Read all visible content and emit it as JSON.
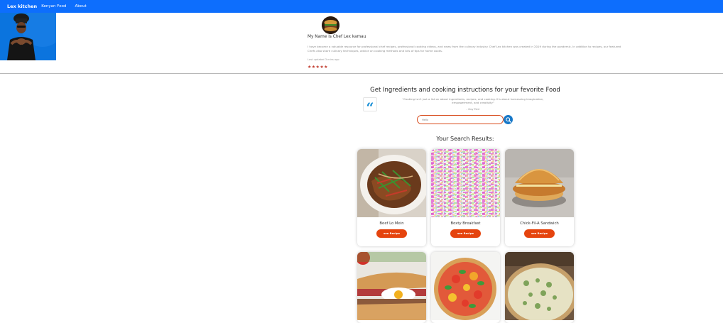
{
  "nav": {
    "brand": "Lex kitchen",
    "links": [
      "Kenyan Food",
      "About"
    ]
  },
  "profile": {
    "name": "My Name is Chef Lex kamau",
    "bio": "I have become a valuable resource for professional chef recipes, professional cooking videos, and news from the culinary industry. Chef Lex kitchen was created in 2019 during the pandemic. In addition to recipes, our featured Chefs also share culinary techniques, advice on cooking methods and lots of tips for home cooks.",
    "updated": "Last updated 3 mins ago",
    "rating": 5,
    "stars": "★★★★★"
  },
  "hero": {
    "headline": "Get Ingredients and cooking instructions for your fevorite Food",
    "quote": "\"Cooking isn't just a list on about ingredients, recipes, and cooking. It's about harnessing imagination, empowerment, and creativity\"",
    "quote_author": "- Guy Fieri",
    "quote_icon": "quote-icon"
  },
  "search": {
    "value": "Hello",
    "button_icon": "search-icon"
  },
  "results": {
    "title": "Your Search Results:",
    "cards": [
      {
        "title": "Beef Lo Mein",
        "button": "see Recipe"
      },
      {
        "title": "Boxty Breakfast",
        "button": "see Recipe"
      },
      {
        "title": "Chick-Fil-A Sandwich",
        "button": "see Recipe"
      },
      {
        "title": "",
        "button": ""
      },
      {
        "title": "",
        "button": ""
      },
      {
        "title": "",
        "button": ""
      }
    ]
  },
  "colors": {
    "navbar": "#0d6efd",
    "accent_button": "#e5440e",
    "search_border": "#d84a1b",
    "search_button": "#1778c8",
    "stars": "#c0392b"
  }
}
